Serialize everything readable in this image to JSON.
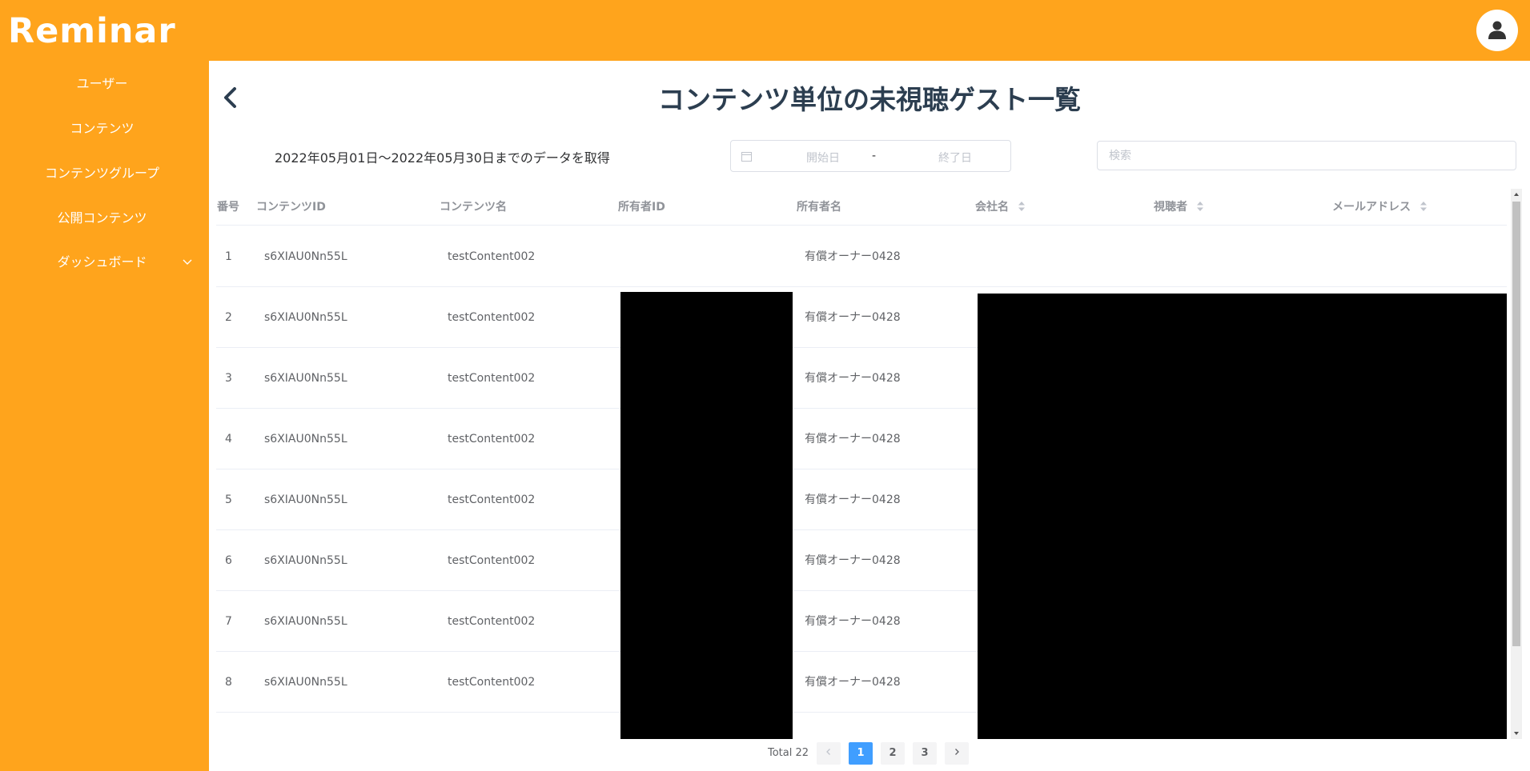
{
  "app": {
    "name": "Reminar"
  },
  "sidebar": {
    "items": [
      {
        "label": "ユーザー"
      },
      {
        "label": "コンテンツ"
      },
      {
        "label": "コンテンツグループ"
      },
      {
        "label": "公開コンテンツ"
      },
      {
        "label": "ダッシュボード",
        "has_children": true
      }
    ]
  },
  "page": {
    "title": "コンテンツ単位の未視聴ゲスト一覧",
    "range_text": "2022年05月01日〜2022年05月30日までのデータを取得",
    "date_picker": {
      "start_placeholder": "開始日",
      "separator": "-",
      "end_placeholder": "終了日"
    },
    "search": {
      "placeholder": "検索"
    }
  },
  "table": {
    "columns": [
      {
        "label": "番号",
        "sortable": false
      },
      {
        "label": "コンテンツID",
        "sortable": false
      },
      {
        "label": "コンテンツ名",
        "sortable": false
      },
      {
        "label": "所有者ID",
        "sortable": false
      },
      {
        "label": "所有者名",
        "sortable": false
      },
      {
        "label": "会社名",
        "sortable": true
      },
      {
        "label": "視聴者",
        "sortable": true
      },
      {
        "label": "メールアドレス",
        "sortable": true
      }
    ],
    "rows": [
      {
        "no": "1",
        "content_id": "s6XIAU0Nn55L",
        "content_name": "testContent002",
        "owner_name": "有償オーナー0428"
      },
      {
        "no": "2",
        "content_id": "s6XIAU0Nn55L",
        "content_name": "testContent002",
        "owner_name": "有償オーナー0428"
      },
      {
        "no": "3",
        "content_id": "s6XIAU0Nn55L",
        "content_name": "testContent002",
        "owner_name": "有償オーナー0428"
      },
      {
        "no": "4",
        "content_id": "s6XIAU0Nn55L",
        "content_name": "testContent002",
        "owner_name": "有償オーナー0428"
      },
      {
        "no": "5",
        "content_id": "s6XIAU0Nn55L",
        "content_name": "testContent002",
        "owner_name": "有償オーナー0428"
      },
      {
        "no": "6",
        "content_id": "s6XIAU0Nn55L",
        "content_name": "testContent002",
        "owner_name": "有償オーナー0428"
      },
      {
        "no": "7",
        "content_id": "s6XIAU0Nn55L",
        "content_name": "testContent002",
        "owner_name": "有償オーナー0428"
      },
      {
        "no": "8",
        "content_id": "s6XIAU0Nn55L",
        "content_name": "testContent002",
        "owner_name": "有償オーナー0428"
      }
    ]
  },
  "pagination": {
    "total_text": "Total 22",
    "pages": [
      "1",
      "2",
      "3"
    ],
    "current": "1",
    "prev_icon": "chevron-left-icon",
    "next_icon": "chevron-right-icon"
  },
  "colors": {
    "brand": "#ffa41c",
    "title": "#2c3e50",
    "active_page": "#409eff",
    "redaction": "#000000"
  }
}
